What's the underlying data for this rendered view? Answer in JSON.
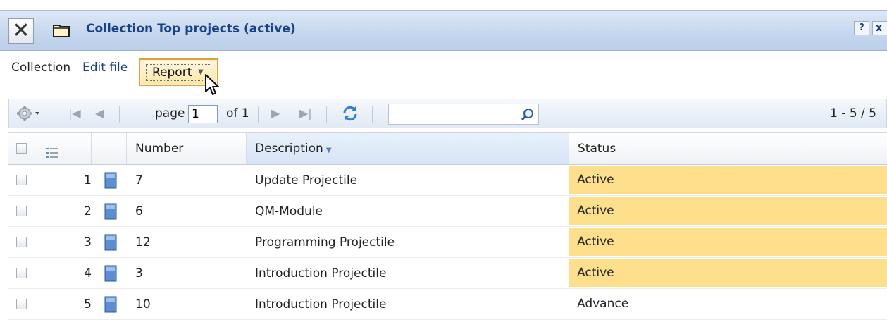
{
  "window": {
    "title": "Collection Top projects (active)",
    "help_label": "?",
    "close_label": "x"
  },
  "menu": {
    "collection_label": "Collection",
    "edit_file_label": "Edit file",
    "report_label": "Report"
  },
  "pager": {
    "page_label": "page",
    "page_value": "1",
    "of_label": "of 1",
    "search_value": "",
    "count_label": "1 - 5 / 5"
  },
  "grid": {
    "columns": [
      "Number",
      "Description",
      "Status"
    ],
    "rows": [
      {
        "row_no": "1",
        "number": "7",
        "description": "Update Projectile",
        "status": "Active"
      },
      {
        "row_no": "2",
        "number": "6",
        "description": "QM-Module",
        "status": "Active"
      },
      {
        "row_no": "3",
        "number": "12",
        "description": "Programming Projectile",
        "status": "Active"
      },
      {
        "row_no": "4",
        "number": "3",
        "description": "Introduction Projectile",
        "status": "Active"
      },
      {
        "row_no": "5",
        "number": "10",
        "description": "Introduction Projectile",
        "status": "Advance"
      }
    ]
  },
  "colors": {
    "title_text": "#15428b",
    "active_status_bg": "#fedf8c",
    "report_button_border": "#d8a43a"
  },
  "icons": [
    "close-icon",
    "folder-icon",
    "gear-icon",
    "first-page-icon",
    "prev-page-icon",
    "next-page-icon",
    "last-page-icon",
    "refresh-icon",
    "search-icon",
    "row-numbering-icon",
    "document-icon",
    "mouse-cursor-icon"
  ]
}
